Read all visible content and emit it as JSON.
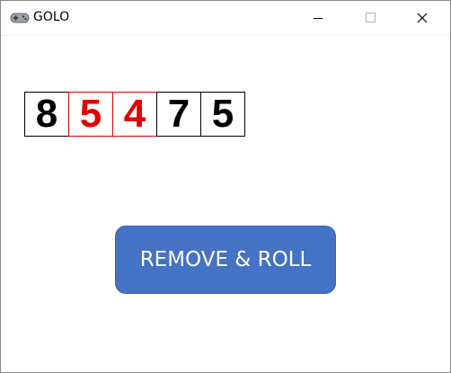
{
  "window": {
    "title": "GOLO",
    "icon": "gamepad-icon",
    "controls": [
      "minimize-icon",
      "maximize-icon",
      "close-icon"
    ]
  },
  "dice": [
    {
      "value": "8",
      "color": "#000000",
      "selected": false
    },
    {
      "value": "5",
      "color": "#e00000",
      "selected": true
    },
    {
      "value": "4",
      "color": "#e00000",
      "selected": true
    },
    {
      "value": "7",
      "color": "#000000",
      "selected": false
    },
    {
      "value": "5",
      "color": "#000000",
      "selected": false
    }
  ],
  "actions": {
    "remove_roll_label": "REMOVE & ROLL",
    "button_color": "#4472c4"
  }
}
